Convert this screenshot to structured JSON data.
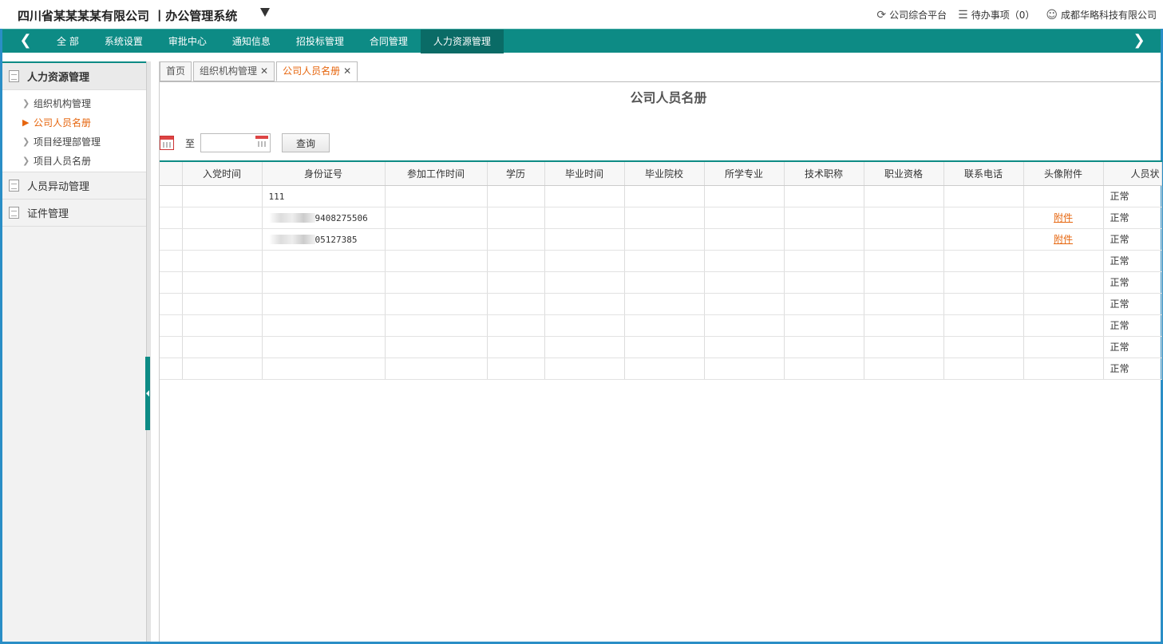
{
  "header": {
    "title": "四川省某某某某有限公司 丨办公管理系统",
    "links": [
      {
        "label": "公司综合平台",
        "icon": "refresh-icon"
      },
      {
        "label": "待办事项（0）",
        "icon": "checklist-icon"
      },
      {
        "label": "成都华略科技有限公司",
        "icon": "user-icon"
      }
    ]
  },
  "nav": {
    "items": [
      "全 部",
      "系统设置",
      "审批中心",
      "通知信息",
      "招投标管理",
      "合同管理",
      "人力资源管理"
    ],
    "active_index": 6
  },
  "sidebar": {
    "groups": [
      {
        "label": "人力资源管理",
        "open": true,
        "items": [
          "组织机构管理",
          "公司人员名册",
          "项目经理部管理",
          "项目人员名册"
        ],
        "active_item": 1
      },
      {
        "label": "人员异动管理"
      },
      {
        "label": "证件管理"
      }
    ]
  },
  "tabs": [
    {
      "label": "首页",
      "closable": false
    },
    {
      "label": "组织机构管理",
      "closable": true
    },
    {
      "label": "公司人员名册",
      "closable": true,
      "active": true
    }
  ],
  "page": {
    "title": "公司人员名册",
    "to_label": "至",
    "query_button": "查询"
  },
  "table": {
    "columns": [
      "",
      "入党时间",
      "身份证号",
      "参加工作时间",
      "学历",
      "毕业时间",
      "毕业院校",
      "所学专业",
      "技术职称",
      "职业资格",
      "联系电话",
      "头像附件",
      "人员状"
    ],
    "rows": [
      {
        "id_number": "111",
        "attachment": "",
        "status": "正常"
      },
      {
        "id_number": "9408275506",
        "id_masked": true,
        "attachment": "附件",
        "status": "正常"
      },
      {
        "id_number": "05127385",
        "id_masked": true,
        "attachment": "附件",
        "status": "正常"
      },
      {
        "id_number": "",
        "attachment": "",
        "status": "正常"
      },
      {
        "id_number": "",
        "attachment": "",
        "status": "正常"
      },
      {
        "id_number": "",
        "attachment": "",
        "status": "正常"
      },
      {
        "id_number": "",
        "attachment": "",
        "status": "正常"
      },
      {
        "id_number": "",
        "attachment": "",
        "status": "正常"
      },
      {
        "id_number": "",
        "attachment": "",
        "status": "正常"
      }
    ]
  },
  "colors": {
    "nav_bg": "#0d8b85",
    "accent": "#e6650d",
    "frame": "#2a8ec6"
  }
}
